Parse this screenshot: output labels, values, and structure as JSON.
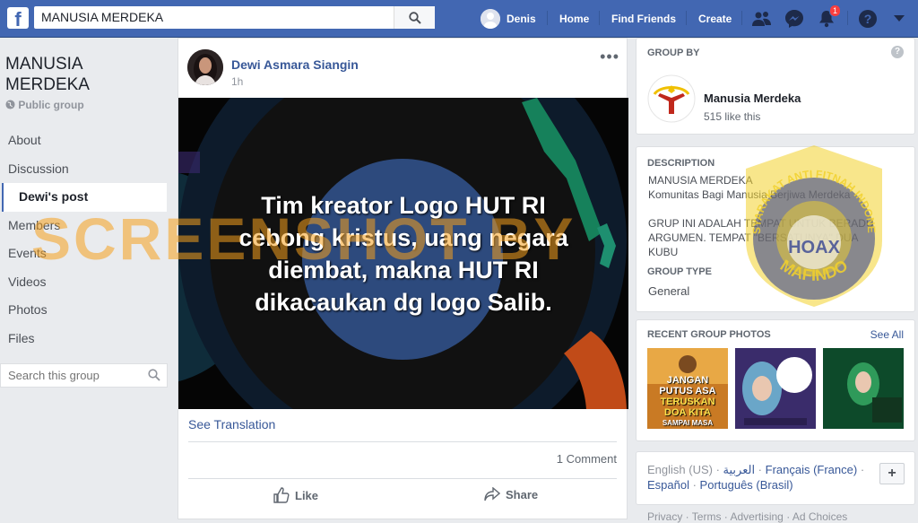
{
  "topbar": {
    "logo": "f",
    "search_value": "MANUSIA MERDEKA",
    "user_name": "Denis",
    "nav": [
      "Home",
      "Find Friends",
      "Create"
    ],
    "notification_count": "1"
  },
  "left": {
    "group_name": "MANUSIA MERDEKA",
    "group_type": "Public group",
    "menu": [
      "About",
      "Discussion",
      "Dewi's post",
      "Members",
      "Events",
      "Videos",
      "Photos",
      "Files"
    ],
    "search_placeholder": "Search this group"
  },
  "post": {
    "author": "Dewi Asmara Siangin",
    "time": "1h",
    "image_text": [
      "Tim kreator Logo HUT RI",
      "cebong kristus, uang negara",
      "diembat, makna HUT RI",
      "dikacaukan dg logo Salib."
    ],
    "see_translation": "See Translation",
    "comments": "1 Comment",
    "like": "Like",
    "share": "Share"
  },
  "right": {
    "group_by_label": "GROUP BY",
    "owner_name": "Manusia Merdeka",
    "owner_likes": "515 like this",
    "description_label": "DESCRIPTION",
    "description_lines": [
      "MANUSIA MERDEKA",
      "Komunitas Bagi Manusia Berjiwa Merdeka",
      "",
      "GRUP INI ADALAH TEMPAT UNTUK BERADU",
      "ARGUMEN. TEMPAT \"BERSATUNYA\" DUA",
      "KUBU"
    ],
    "group_type_label": "GROUP TYPE",
    "group_type_value": "General",
    "photos_label": "RECENT GROUP PHOTOS",
    "see_all": "See All",
    "photo1_text": [
      "JANGAN",
      "PUTUS ASA",
      "TERUSKAN",
      "DOA KITA",
      "SAMPAI MASA"
    ],
    "languages_line1": [
      "English (US)",
      "العربية",
      "Français (France)"
    ],
    "languages_line2": [
      "Español",
      "Português (Brasil)"
    ],
    "add_language": "+",
    "footer_links": [
      "Privacy",
      "Terms",
      "Advertising",
      "Ad Choices"
    ]
  },
  "overlay": {
    "watermark": "SCREENSHOT BY",
    "seal_top": "MASYARAKAT ANTI FITNAH INDONESIA",
    "seal_center": "HOAX",
    "seal_bottom": "MAFINDO"
  },
  "colors": {
    "brand": "#4267b2",
    "link": "#385898",
    "watermark": "#f5a01e",
    "seal_blue": "#2b3a8f",
    "seal_gold": "#f2d12c"
  }
}
